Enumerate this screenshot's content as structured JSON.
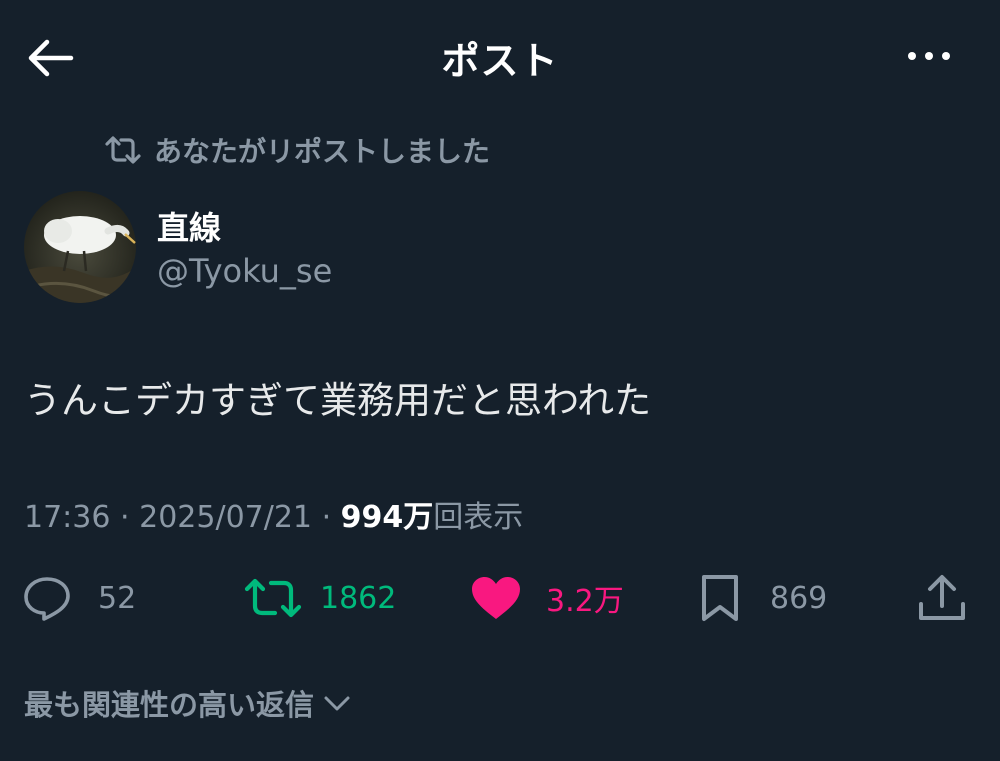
{
  "header": {
    "title": "ポスト",
    "back_icon": "arrow-left-icon",
    "more_icon": "more-horizontal-icon"
  },
  "repost_line": {
    "text": "あなたがリポストしました",
    "icon": "repost-icon"
  },
  "author": {
    "name": "直線",
    "handle": "@Tyoku_se"
  },
  "post": {
    "text": "うんこデカすぎて業務用だと思われた"
  },
  "meta": {
    "time": "17:36",
    "date": "2025/07/21",
    "separator": "·",
    "views_count": "994万",
    "views_label": "回表示"
  },
  "actions": {
    "reply_count": "52",
    "repost_count": "1862",
    "like_count": "3.2万",
    "bookmark_count": "869"
  },
  "relevant_replies": {
    "label": "最も関連性の高い返信"
  },
  "colors": {
    "background": "#15202b",
    "text_primary": "#e7e9ea",
    "text_secondary": "#8b98a5",
    "repost_green": "#00ba7c",
    "like_pink": "#f91880"
  }
}
